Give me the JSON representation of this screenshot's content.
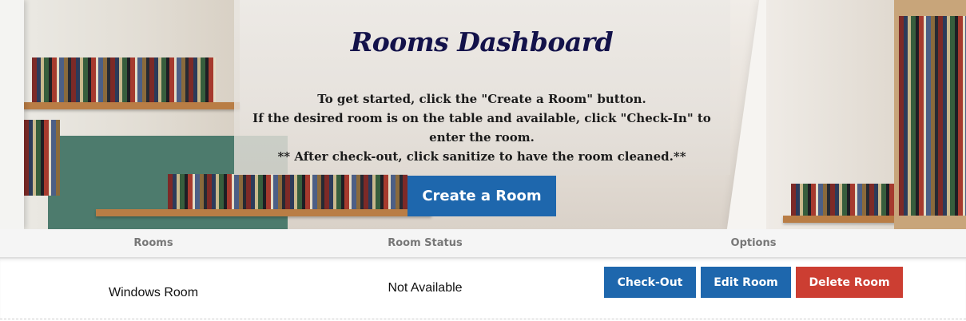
{
  "header": {
    "title": "Rooms Dashboard",
    "instructions": [
      "To get started, click the \"Create a Room\" button.",
      "If the desired room is on the table and available, click \"Check-In\" to",
      "enter the room.",
      "** After check-out, click sanitize to have the room cleaned.**"
    ],
    "create_button_label": "Create a Room"
  },
  "table": {
    "columns": [
      "Rooms",
      "Room Status",
      "Options"
    ],
    "rows": [
      {
        "room": "Windows Room",
        "status": "Not Available",
        "actions": [
          "Check-Out",
          "Edit Room",
          "Delete Room"
        ]
      }
    ]
  },
  "colors": {
    "title": "#13124a",
    "primary_button": "#1e67ad",
    "danger_button": "#cc3e32",
    "header_text": "#777777"
  },
  "background": {
    "image": "library bookshelves photo",
    "icon": "photo-background"
  }
}
